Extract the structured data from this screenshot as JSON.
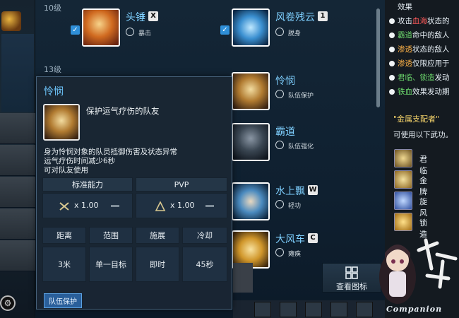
{
  "skill_list": {
    "levels": [
      {
        "label": "10级"
      },
      {
        "label": "13级"
      }
    ],
    "rows": [
      {
        "name": "头锤",
        "key": "X",
        "sub": "暴击",
        "checked": true
      },
      {
        "name": "风卷残云",
        "key": "1",
        "sub": "脱身",
        "checked": true
      },
      {
        "name": "怜悯",
        "key": "",
        "sub": "队伍保护",
        "checked": false
      },
      {
        "name": "霸道",
        "key": "",
        "sub": "队伍强化",
        "checked": false
      },
      {
        "name": "水上飘",
        "key": "W",
        "sub": "轻功",
        "checked": false
      },
      {
        "name": "大风车",
        "key": "C",
        "sub": "瘫痪",
        "checked": false
      }
    ],
    "view_icons_label": "查看图标"
  },
  "tooltip": {
    "title": "怜悯",
    "summary": "保护运气疗伤的队友",
    "desc": [
      "身为怜悯对象的队员抵御伤害及状态异常",
      "运气疗伤时间减少6秒",
      "可对队友使用"
    ],
    "headers": [
      "标准能力",
      "PVP"
    ],
    "multipliers": [
      "x 1.00",
      "x 1.00"
    ],
    "stat_labels": [
      "距离",
      "范围",
      "施展",
      "冷却"
    ],
    "stat_values": [
      "3米",
      "单一目标",
      "即时",
      "45秒"
    ],
    "tag": "队伍保护"
  },
  "right_panel": {
    "lines": [
      {
        "pre": "",
        "hl": "",
        "post": "效果",
        "dot": false,
        "cls": ""
      },
      {
        "pre": "攻击",
        "hl": "血海",
        "post": "状态的",
        "dot": true,
        "cls": "red"
      },
      {
        "pre": "",
        "hl": "霸道",
        "post": "命中的敌人",
        "dot": true,
        "cls": "green"
      },
      {
        "pre": "",
        "hl": "渗透",
        "post": "状态的敌人",
        "dot": true,
        "cls": "orange"
      },
      {
        "pre": "",
        "hl": "渗透",
        "post": "仅限应用于",
        "dot": true,
        "cls": "orange"
      },
      {
        "pre": "",
        "hl": "君临、锁造",
        "post": "发动",
        "dot": true,
        "cls": "green"
      },
      {
        "pre": "",
        "hl": "铁血",
        "post": "效果发动期",
        "dot": true,
        "cls": "green"
      }
    ],
    "metal_title": "\"金属支配者\"",
    "usable_text": "可使用以下武功。",
    "weapons": [
      {
        "name": "君临"
      },
      {
        "name": "金牌"
      },
      {
        "name": "旋风"
      },
      {
        "name": "锁造"
      }
    ]
  },
  "companion": {
    "name": "Companion"
  },
  "colors": {
    "accent": "#6fc8ff",
    "tag": "#2a5f9a",
    "panel": "#1a2634"
  }
}
